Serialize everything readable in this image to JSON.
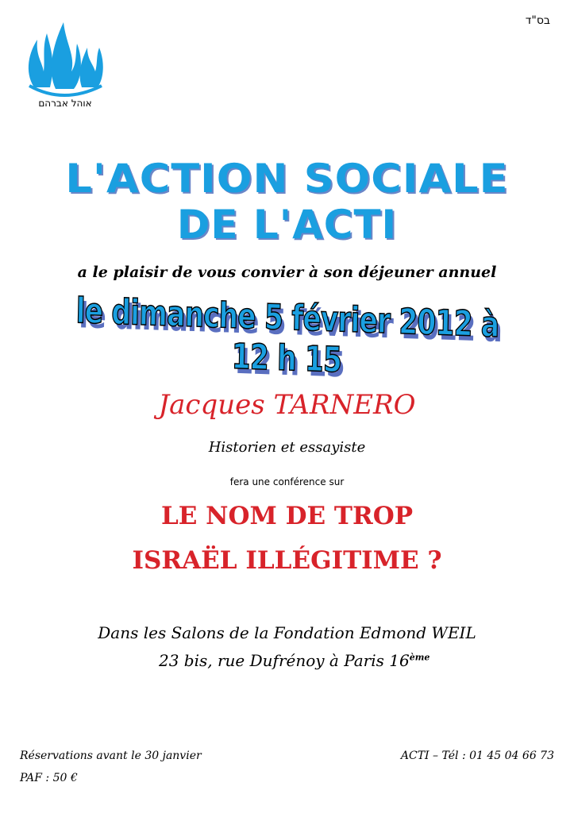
{
  "header": {
    "bsd": "בס\"ד",
    "logo_text": "אוהל אברהם"
  },
  "title": {
    "line1": "L'ACTION SOCIALE",
    "line2": "DE L'ACTI"
  },
  "invite": "a le plaisir de vous convier à son déjeuner annuel",
  "date_line": "le dimanche 5 février 2012 à 12 h 15",
  "speaker": {
    "name": "Jacques TARNERO",
    "role": "Historien et essayiste"
  },
  "conference_intro": "fera une conférence sur",
  "topic": {
    "line1": "LE NOM DE TROP",
    "line2": "ISRAËL ILLÉGITIME ?"
  },
  "venue": {
    "line1": "Dans les Salons de la Fondation Edmond WEIL",
    "line2": "23 bis, rue Dufrénoy à Paris 16",
    "line2_sup": "ème"
  },
  "footer": {
    "reservations": "Réservations avant le 30 janvier",
    "paf": "PAF : 50 €",
    "contact": "ACTI – Tél : 01 45 04 66 73"
  },
  "colors": {
    "title_blue": "#1a9fe0",
    "accent_red": "#d8232a"
  }
}
